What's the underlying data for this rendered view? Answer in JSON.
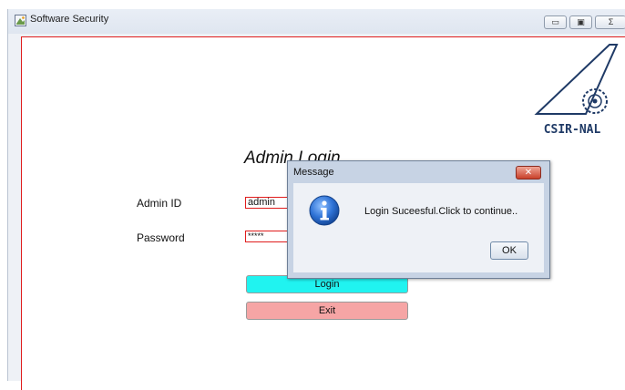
{
  "window": {
    "title": "Software Security",
    "controls": {
      "minimize": "▭",
      "maximize": "▣",
      "close": "Σ"
    }
  },
  "logo": {
    "text": "CSIR-NAL"
  },
  "form": {
    "title": "Admin Login",
    "admin_id_label": "Admin ID",
    "admin_id_value": "admin",
    "password_label": "Password",
    "password_value": "*****",
    "login_button": "Login",
    "exit_button": "Exit"
  },
  "dialog": {
    "title": "Message",
    "close_label": "✕",
    "message": "Login Suceesful.Click to continue..",
    "ok_label": "OK"
  },
  "colors": {
    "login_button_bg": "#20f3f0",
    "exit_button_bg": "#f6a5a5",
    "frame_border": "#e01c1c",
    "info_icon": "#1f63c5"
  }
}
